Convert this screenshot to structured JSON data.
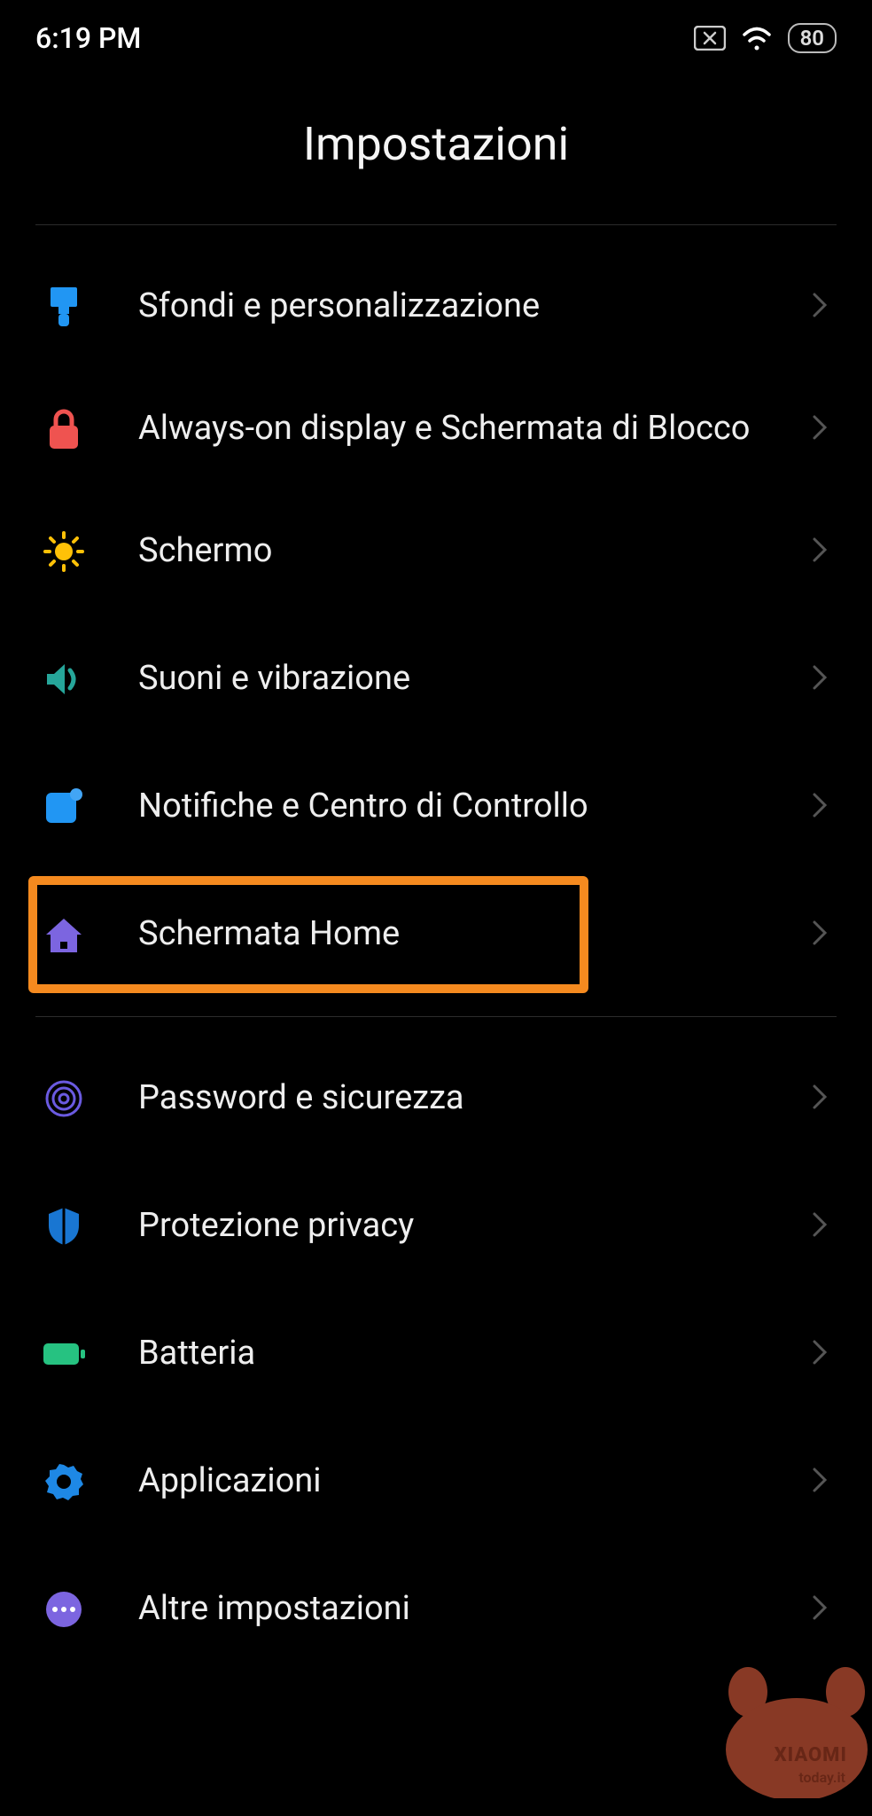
{
  "status": {
    "time": "6:19 PM",
    "battery": "80"
  },
  "page": {
    "title": "Impostazioni"
  },
  "section1": [
    {
      "icon": "brush",
      "label": "Sfondi e personalizzazione"
    },
    {
      "icon": "lock",
      "label": "Always-on display e Schermata di Blocco"
    },
    {
      "icon": "sun",
      "label": "Schermo"
    },
    {
      "icon": "speaker",
      "label": "Suoni e vibrazione"
    },
    {
      "icon": "notification",
      "label": "Notifiche e Centro di Controllo"
    },
    {
      "icon": "home",
      "label": "Schermata Home",
      "highlighted": true
    }
  ],
  "section2": [
    {
      "icon": "fingerprint",
      "label": "Password e sicurezza"
    },
    {
      "icon": "shield",
      "label": "Protezione privacy"
    },
    {
      "icon": "battery",
      "label": "Batteria"
    },
    {
      "icon": "gear",
      "label": "Applicazioni"
    },
    {
      "icon": "more",
      "label": "Altre impostazioni"
    }
  ],
  "watermark": {
    "brand": "XIAOMI",
    "site": "today.it"
  }
}
